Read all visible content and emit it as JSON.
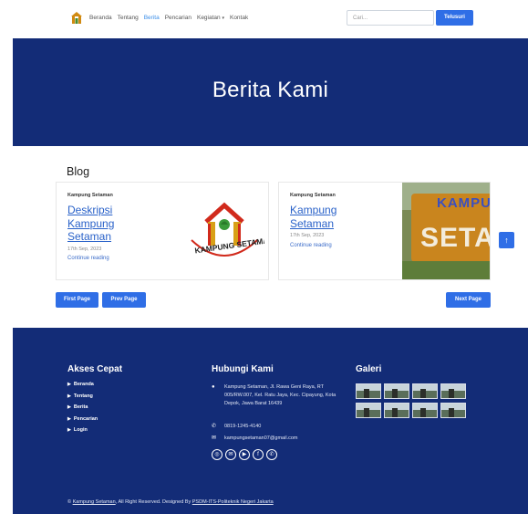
{
  "navbar": {
    "logo_icon": "kampung-logo-icon",
    "links": [
      {
        "label": "Beranda",
        "active": false
      },
      {
        "label": "Tentang",
        "active": false
      },
      {
        "label": "Berita",
        "active": true
      },
      {
        "label": "Pencarian",
        "active": false
      },
      {
        "label": "Kegiatan",
        "active": false
      },
      {
        "label": "Kontak",
        "active": false
      }
    ],
    "dropdown_caret": "▾",
    "search_placeholder": "Cari...",
    "search_button": "Telusuri"
  },
  "hero": {
    "title": "Berita Kami"
  },
  "blog": {
    "section_title": "Blog",
    "cards": [
      {
        "category": "Kampung Setaman",
        "heading": "Deskripsi Kampung Setaman",
        "date": "17th Sep, 2023",
        "link": "Continue reading",
        "logo_text": "KAMPUNG SETAMAN"
      },
      {
        "category": "Kampung Setaman",
        "heading": "Kampung Setaman",
        "date": "17th Sep, 2023",
        "link": "Continue reading",
        "photo_text_top": "KAMPU",
        "photo_text_main": "SETA"
      }
    ],
    "scroll_top": "↑"
  },
  "pagination": {
    "first": "First Page",
    "prev": "Prev Page",
    "next": "Next Page"
  },
  "footer": {
    "quick_title": "Akses Cepat",
    "quick_links": [
      "Beranda",
      "Tentang",
      "Berita",
      "Pencarian",
      "Login"
    ],
    "contact_title": "Hubungi Kami",
    "address": "Kampung Setaman, Jl. Rawa Geni Raya, RT 005/RW.007, Kel. Ratu Jaya, Kec. Cipayung, Kota Depok, Jawa Barat 16439",
    "phone": "0819-1245-4140",
    "email": "kampungsetaman07@gmail.com",
    "social_icons": [
      "instagram-icon",
      "email-icon",
      "youtube-icon",
      "facebook-icon",
      "whatsapp-icon"
    ],
    "gallery_title": "Galeri",
    "gallery_count": 8,
    "copyright_prefix": "© ",
    "copyright_brand": "Kampung Setaman",
    "copyright_mid": ", All Right Reserved. Designed By ",
    "copyright_designer": "PSDM-ITS-Politeknik Negeri Jakarta"
  }
}
